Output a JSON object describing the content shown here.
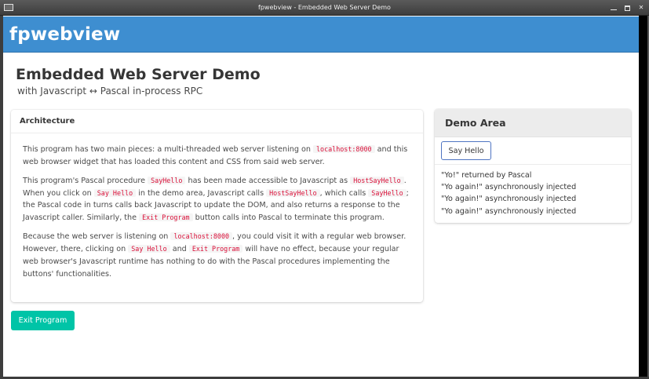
{
  "window": {
    "title": "fpwebview - Embedded Web Server Demo"
  },
  "navbar": {
    "brand": "fpwebview"
  },
  "page": {
    "title": "Embedded Web Server Demo",
    "subtitle": "with Javascript ↔ Pascal in-process RPC"
  },
  "architecture": {
    "header": "Architecture",
    "p1": {
      "t1": "This program has two main pieces: a multi-threaded web server listening on ",
      "c1": "localhost:8000",
      "t2": " and this web browser widget that has loaded this content and CSS from said web server."
    },
    "p2": {
      "t1": "This program's Pascal procedure ",
      "c1": "SayHello",
      "t2": " has been made accessible to Javascript as ",
      "c2": "HostSayHello",
      "t3": ". When you click on ",
      "c3": "Say Hello",
      "t4": " in the demo area, Javascript calls ",
      "c4": "HostSayHello",
      "t5": ", which calls ",
      "c5": "SayHello",
      "t6": "; the Pascal code in turns calls back Javascript to update the DOM, and also returns a response to the Javascript caller. Similarly, the ",
      "c6": "Exit Program",
      "t7": " button calls into Pascal to terminate this program."
    },
    "p3": {
      "t1": "Because the web server is listening on ",
      "c1": "localhost:8000",
      "t2": ", you could visit it with a regular web browser. However, there, clicking on ",
      "c2": "Say Hello",
      "t3": " and ",
      "c3": "Exit Program",
      "t4": " will have no effect, because your regular web browser's Javascript runtime has nothing to do with the Pascal procedures implementing the buttons' functionalities."
    }
  },
  "demo": {
    "header": "Demo Area",
    "button_label": "Say Hello",
    "log": [
      "\"Yo!\" returned by Pascal",
      "\"Yo again!\" asynchronously injected",
      "\"Yo again!\" asynchronously injected",
      "\"Yo again!\" asynchronously injected"
    ]
  },
  "exit_button_label": "Exit Program"
}
